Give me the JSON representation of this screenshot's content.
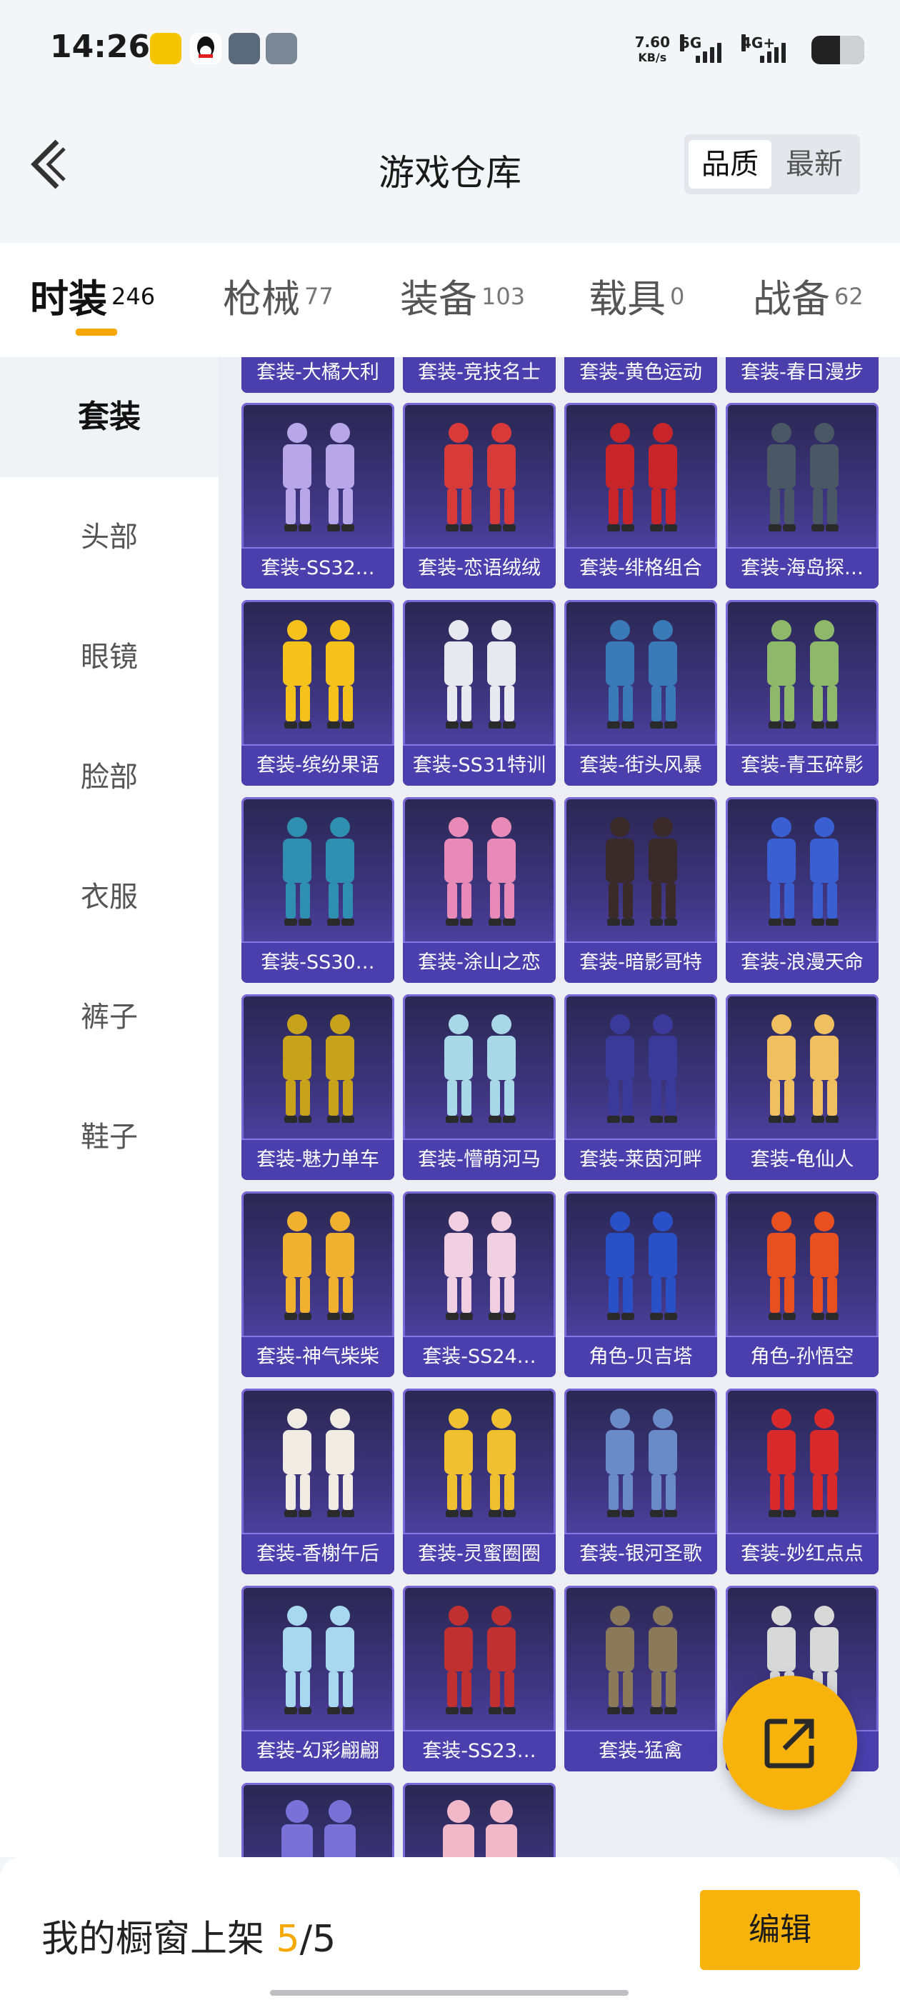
{
  "status": {
    "time": "14:26",
    "net_speed": "7.60",
    "net_unit": "KB/s",
    "sig1": "5G",
    "sig2": "4G+"
  },
  "header": {
    "title": "游戏仓库",
    "sort_options": [
      "品质",
      "最新"
    ],
    "sort_selected": "品质"
  },
  "tabs": [
    {
      "label": "时装",
      "count": "246"
    },
    {
      "label": "枪械",
      "count": "77"
    },
    {
      "label": "装备",
      "count": "103"
    },
    {
      "label": "载具",
      "count": "0"
    },
    {
      "label": "战备",
      "count": "62"
    }
  ],
  "sidebar": [
    "套装",
    "头部",
    "眼镜",
    "脸部",
    "衣服",
    "裤子",
    "鞋子"
  ],
  "items_top_partial": [
    "套装-大橘大利",
    "套装-竞技名士",
    "套装-黄色运动",
    "套装-春日漫步"
  ],
  "items": [
    "套装-SS32…",
    "套装-恋语绒绒",
    "套装-绯格组合",
    "套装-海岛探…",
    "套装-缤纷果语",
    "套装-SS31特训",
    "套装-街头风暴",
    "套装-青玉碎影",
    "套装-SS30…",
    "套装-涂山之恋",
    "套装-暗影哥特",
    "套装-浪漫天命",
    "套装-魅力单车",
    "套装-懵萌河马",
    "套装-莱茵河畔",
    "套装-龟仙人",
    "套装-神气柴柴",
    "套装-SS24…",
    "角色-贝吉塔",
    "角色-孙悟空",
    "套装-香榭午后",
    "套装-灵蜜圈圈",
    "套装-银河圣歌",
    "套装-妙红点点",
    "套装-幻彩翩翩",
    "套装-SS23…",
    "套装-猛禽",
    "…者"
  ],
  "bottom": {
    "showcase_prefix": "我的橱窗上架",
    "showcase_current": "5",
    "showcase_total": "/5",
    "edit_label": "编辑"
  },
  "colors": {
    "accent": "#f5a900",
    "card_bg": "#3f3682",
    "card_label": "#4b3fae"
  }
}
